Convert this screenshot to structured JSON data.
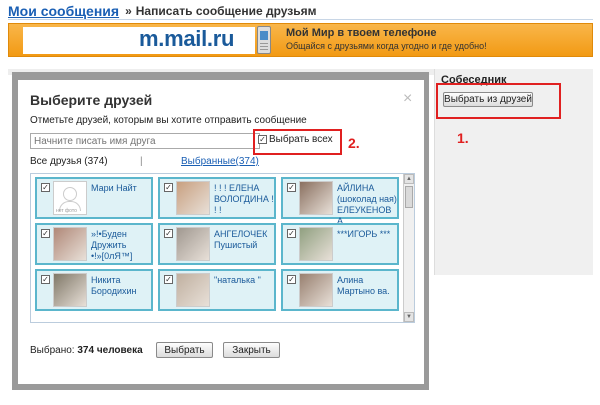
{
  "breadcrumb": {
    "link": "Мои сообщения",
    "separator": "»",
    "current": "Написать сообщение друзьям"
  },
  "banner": {
    "logo": "m.mail.ru",
    "title": "Мой Мир в твоем телефоне",
    "subtitle": "Общайся с друзьями когда угодно и где удобно!"
  },
  "right_panel": {
    "label": "Собеседник",
    "button": "Выбрать из друзей",
    "annotation": "1."
  },
  "dialog": {
    "title": "Выберите друзей",
    "close_glyph": "×",
    "instruction": "Отметьте друзей, которым вы хотите отправить сообщение",
    "search_placeholder": "Начните писать имя друга",
    "select_all_label": "Выбрать всех",
    "select_all_checked": true,
    "annotation": "2.",
    "tab_all": "Все друзья (374)",
    "tab_separator": "|",
    "tab_selected": "Выбранные(374)",
    "friends": [
      {
        "name": "Мари Найт",
        "photo": "no-photo",
        "no_photo_text": "нет фото",
        "checked": true
      },
      {
        "name": "! ! ! ЕЛЕНА ВОЛОГДИНА ! ! !",
        "photo": "photo",
        "checked": true
      },
      {
        "name": "АЙЛИНА (шоколад ная) ЕЛЕУКЕНОВА",
        "photo": "photo",
        "checked": true
      },
      {
        "name": "»!•Буден Дружить •!»[0лЯ™]",
        "photo": "photo",
        "checked": true
      },
      {
        "name": "АНГЕЛОЧЕК Пушистый",
        "photo": "photo",
        "checked": true
      },
      {
        "name": "***ИГОРЬ ***",
        "photo": "photo",
        "checked": true
      },
      {
        "name": "Никита Бородихин",
        "photo": "photo",
        "checked": true
      },
      {
        "name": "\"наталька \"",
        "photo": "photo",
        "checked": true
      },
      {
        "name": "Алина Мартыно ва.",
        "photo": "photo",
        "checked": true
      }
    ],
    "chosen_label": "Выбрано:",
    "chosen_count": "374 человека",
    "select_button": "Выбрать",
    "close_button": "Закрыть"
  },
  "colors": {
    "accent_red": "#e02020",
    "link_blue": "#1a5fb4",
    "card_bg": "#dff2f6",
    "card_border": "#5bb6cc",
    "banner_orange": "#f29a14"
  }
}
